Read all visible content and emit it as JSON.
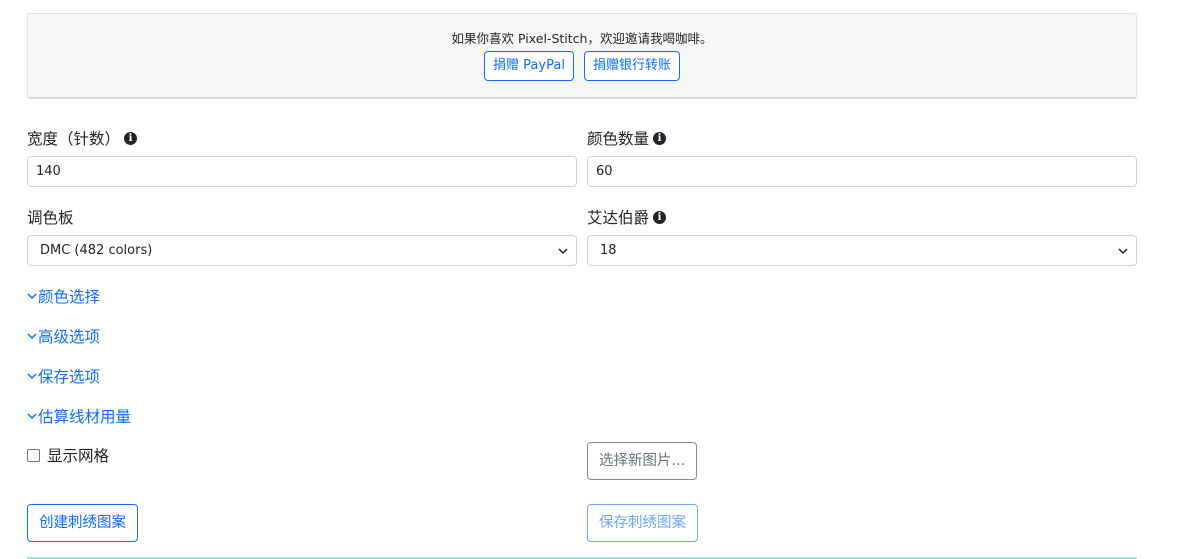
{
  "donate": {
    "message": "如果你喜欢 Pixel-Stitch，欢迎邀请我喝咖啡。",
    "paypal_label": "捐赠 PayPal",
    "bank_label": "捐赠银行转账"
  },
  "width": {
    "label": "宽度（针数）",
    "value": "140"
  },
  "color_count": {
    "label": "颜色数量",
    "value": "60"
  },
  "palette": {
    "label": "调色板",
    "selected": "DMC (482 colors)"
  },
  "aida": {
    "label": "艾达伯爵",
    "selected": "18"
  },
  "sections": {
    "color_selection": "颜色选择",
    "advanced_options": "高级选项",
    "save_options": "保存选项",
    "estimate_thread": "估算线材用量"
  },
  "show_grid_label": "显示网格",
  "choose_image_label": "选择新图片...",
  "create_pattern_label": "创建刺绣图案",
  "save_pattern_label": "保存刺绣图案",
  "colors": {
    "primary": "#0d6efd",
    "primary_disabled": "#6ea8fe",
    "border": "#ced4da"
  }
}
